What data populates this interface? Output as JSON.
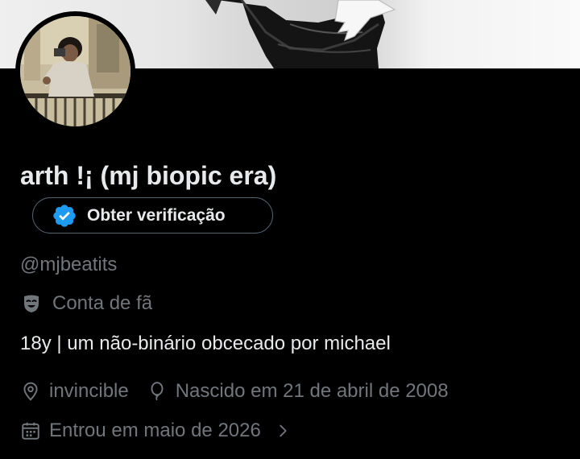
{
  "profile": {
    "display_name": "arth !¡ (mj biopic era)",
    "verify_button_label": "Obter verificação",
    "handle": "@mjbeatits",
    "account_type": "Conta de fã",
    "bio": "18y | um não-binário obcecado por michael",
    "location": "invincible",
    "birthday": "Nascido em 21 de abril de 2008",
    "joined": "Entrou em maio de 2026"
  },
  "icons": {
    "verify_badge": "verified-badge-icon",
    "fan_account": "theater-mask-icon",
    "location": "location-pin-icon",
    "birthday": "balloon-icon",
    "joined": "calendar-icon",
    "joined_more": "chevron-right-icon"
  },
  "colors": {
    "background": "#000000",
    "primary_text": "#e7e9ea",
    "secondary_text": "#71767b",
    "verified_blue": "#1d9bf0",
    "button_border": "#536471"
  }
}
